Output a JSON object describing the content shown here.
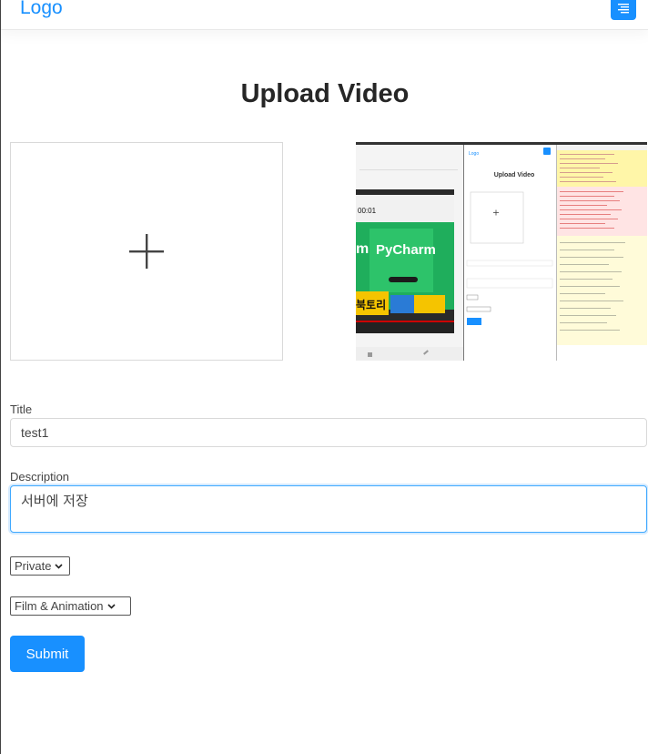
{
  "navbar": {
    "logo": "Logo"
  },
  "page": {
    "title": "Upload Video"
  },
  "form": {
    "title_label": "Title",
    "title_value": "test1",
    "description_label": "Description",
    "description_value": "서버에 저장",
    "privacy_selected": "Private",
    "category_selected": "Film & Animation",
    "submit_label": "Submit"
  },
  "thumbnail": {
    "mini_logo": "Logo",
    "mini_title": "Upload Video",
    "timer": "00:01",
    "banner_text": "PyCharm",
    "banner_left": "m",
    "banner_bottom": "북토리"
  },
  "colors": {
    "accent": "#1890ff",
    "border": "#d9d9d9"
  }
}
